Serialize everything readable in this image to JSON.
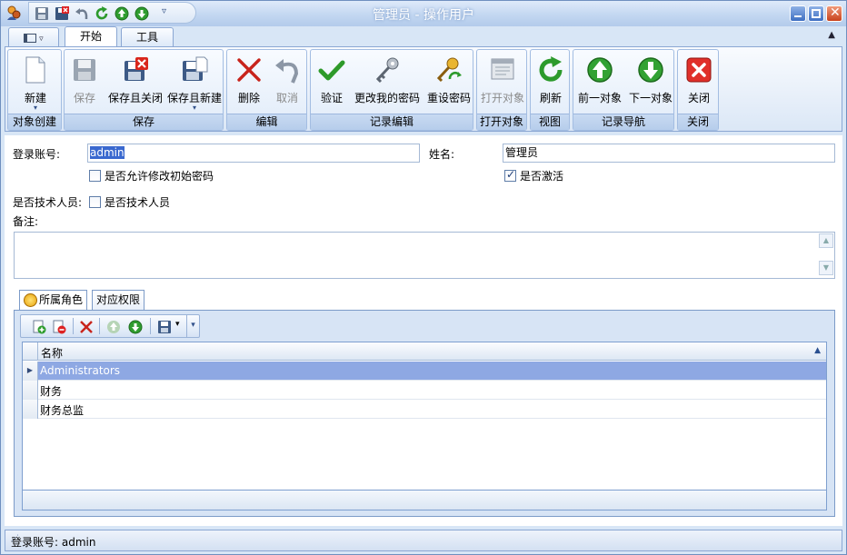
{
  "window": {
    "title": "管理员 - 操作用户"
  },
  "tabs": [
    {
      "label": "开始"
    },
    {
      "label": "工具"
    }
  ],
  "ribbon": {
    "groups": [
      {
        "label": "对象创建"
      },
      {
        "label": "保存"
      },
      {
        "label": "编辑"
      },
      {
        "label": "记录编辑"
      },
      {
        "label": "打开对象"
      },
      {
        "label": "视图"
      },
      {
        "label": "记录导航"
      },
      {
        "label": "关闭"
      }
    ],
    "buttons": {
      "new": "新建",
      "save": "保存",
      "save_close": "保存且关闭",
      "save_new": "保存且新建",
      "delete": "删除",
      "cancel": "取消",
      "validate": "验证",
      "change_my_password": "更改我的密码",
      "reset_password": "重设密码",
      "open_object": "打开对象",
      "refresh": "刷新",
      "prev_object": "前一对象",
      "next_object": "下一对象",
      "close": "关闭"
    }
  },
  "form": {
    "login_label": "登录账号:",
    "login_value": "admin",
    "name_label": "姓名:",
    "name_value": "管理员",
    "allow_change_pwd_label": "是否允许修改初始密码",
    "allow_change_pwd_checked": false,
    "active_label": "是否激活",
    "active_checked": true,
    "is_tech_label": "是否技术人员:",
    "is_tech_checkbox_label": "是否技术人员",
    "is_tech_checked": false,
    "remark_label": "备注:",
    "remark_value": ""
  },
  "detail_tabs": [
    {
      "label": "所属角色"
    },
    {
      "label": "对应权限"
    }
  ],
  "grid": {
    "column": "名称",
    "rows": [
      {
        "name": "Administrators"
      },
      {
        "name": "财务"
      },
      {
        "name": "财务总监"
      }
    ],
    "selected_index": 0
  },
  "status": {
    "text": "登录账号: admin"
  }
}
